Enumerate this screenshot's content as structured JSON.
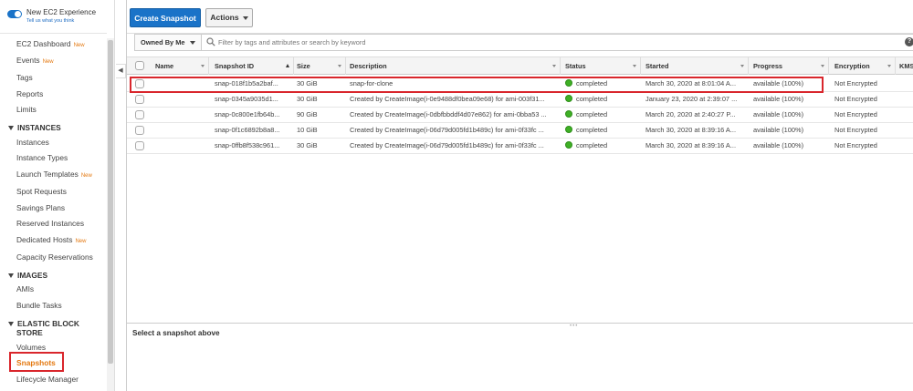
{
  "experience": {
    "title": "New EC2 Experience",
    "link": "Tell us what you think"
  },
  "sidebar": {
    "items": [
      {
        "label": "EC2 Dashboard",
        "new": "New"
      },
      {
        "label": "Events",
        "new": "New"
      },
      {
        "label": "Tags",
        "new": ""
      },
      {
        "label": "Reports",
        "new": ""
      },
      {
        "label": "Limits",
        "new": ""
      }
    ],
    "instances_head": "INSTANCES",
    "instances": [
      {
        "label": "Instances",
        "new": ""
      },
      {
        "label": "Instance Types",
        "new": ""
      },
      {
        "label": "Launch Templates",
        "new": "New"
      },
      {
        "label": "Spot Requests",
        "new": ""
      },
      {
        "label": "Savings Plans",
        "new": ""
      },
      {
        "label": "Reserved Instances",
        "new": ""
      },
      {
        "label": "Dedicated Hosts",
        "new": "New"
      },
      {
        "label": "Capacity Reservations",
        "new": ""
      }
    ],
    "images_head": "IMAGES",
    "images": [
      {
        "label": "AMIs"
      },
      {
        "label": "Bundle Tasks"
      }
    ],
    "ebs_head_1": "ELASTIC BLOCK",
    "ebs_head_2": "STORE",
    "ebs": [
      {
        "label": "Volumes"
      },
      {
        "label": "Snapshots"
      },
      {
        "label": "Lifecycle Manager"
      }
    ]
  },
  "toolbar": {
    "create_label": "Create Snapshot",
    "actions_label": "Actions"
  },
  "filter": {
    "owned_label": "Owned By Me",
    "placeholder": "Filter by tags and attributes or search by keyword",
    "help": "?"
  },
  "table": {
    "headers": [
      "Name",
      "Snapshot ID",
      "Size",
      "Description",
      "Status",
      "Started",
      "Progress",
      "Encryption",
      "KMS"
    ],
    "rows": [
      {
        "name": "",
        "id": "snap-018f1b5a2baf...",
        "size": "30 GiB",
        "desc": "snap-for-clone",
        "status": "completed",
        "started": "March 30, 2020 at 8:01:04 A...",
        "progress": "available (100%)",
        "enc": "Not Encrypted"
      },
      {
        "name": "",
        "id": "snap-0345a9035d1...",
        "size": "30 GiB",
        "desc": "Created by CreateImage(i-0e9488df0bea09e68) for ami-003f31...",
        "status": "completed",
        "started": "January 23, 2020 at 2:39:07 ...",
        "progress": "available (100%)",
        "enc": "Not Encrypted"
      },
      {
        "name": "",
        "id": "snap-0c800e1fb64b...",
        "size": "90 GiB",
        "desc": "Created by CreateImage(i-0dbfbbddf4d07e862) for ami-0bba53 ...",
        "status": "completed",
        "started": "March 20, 2020 at 2:40:27 P...",
        "progress": "available (100%)",
        "enc": "Not Encrypted"
      },
      {
        "name": "",
        "id": "snap-0f1c6892b8a8...",
        "size": "10 GiB",
        "desc": "Created by CreateImage(i-06d79d005fd1b489c) for ami-0f33fc ...",
        "status": "completed",
        "started": "March 30, 2020 at 8:39:16 A...",
        "progress": "available (100%)",
        "enc": "Not Encrypted"
      },
      {
        "name": "",
        "id": "snap-0ffb8f538c961...",
        "size": "30 GiB",
        "desc": "Created by CreateImage(i-06d79d005fd1b489c) for ami-0f33fc ...",
        "status": "completed",
        "started": "March 30, 2020 at 8:39:16 A...",
        "progress": "available (100%)",
        "enc": "Not Encrypted"
      }
    ]
  },
  "bottom": {
    "message": "Select a snapshot above"
  },
  "colors": {
    "primary": "#1a73c8",
    "accent": "#e47911",
    "highlight": "#d9262c",
    "status_ok": "#3fb025"
  }
}
